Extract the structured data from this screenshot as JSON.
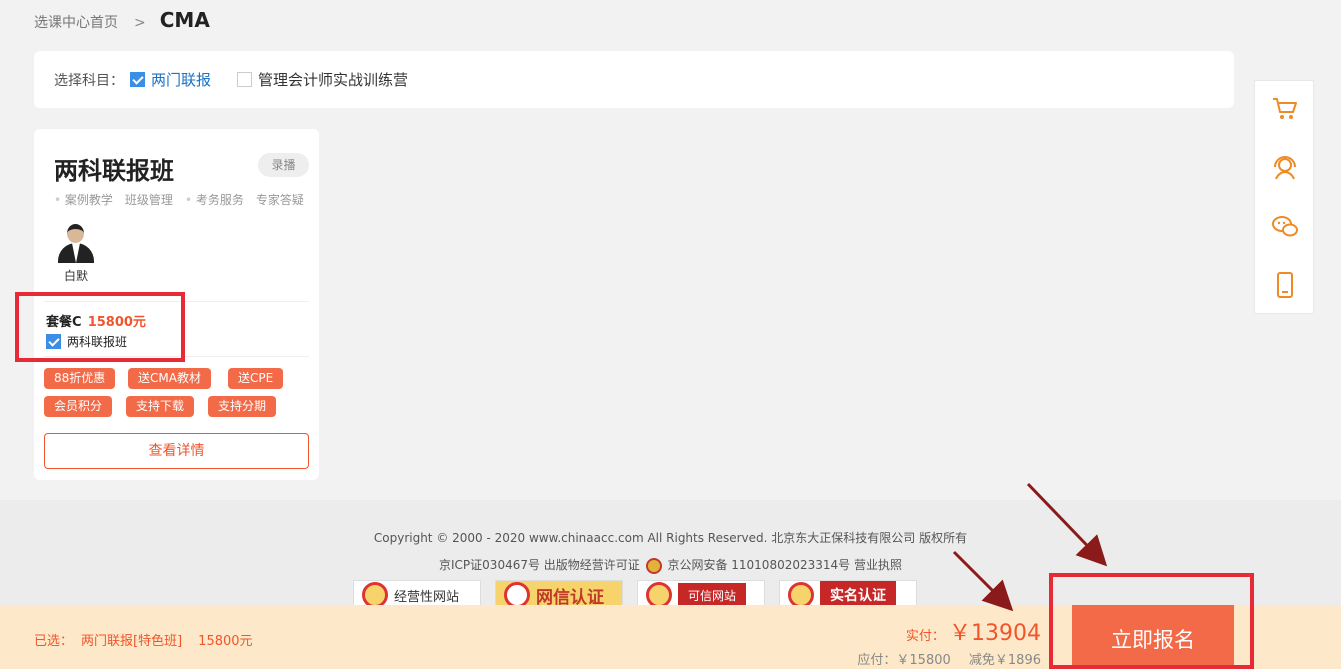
{
  "breadcrumb": {
    "home": "选课中心首页",
    "separator": ">",
    "current": "CMA"
  },
  "filter": {
    "label": "选择科目：",
    "options": [
      {
        "text": "两门联报",
        "checked": true
      },
      {
        "text": "管理会计师实战训练营",
        "checked": false
      }
    ]
  },
  "course": {
    "title": "两科联报班",
    "mode_badge": "录播",
    "features": [
      "案例教学",
      "班级管理",
      "考务服务",
      "专家答疑"
    ],
    "teacher_name": "白默",
    "package_name": "套餐C",
    "package_price": "15800元",
    "package_item": "两科联报班",
    "tags": [
      "88折优惠",
      "送CMA教材",
      "送CPE",
      "会员积分",
      "支持下载",
      "支持分期"
    ],
    "detail_button": "查看详情"
  },
  "sidebar": {
    "icons": [
      "cart-icon",
      "customer-service-icon",
      "chat-icon",
      "mobile-icon"
    ]
  },
  "footer": {
    "copyright": "Copyright © 2000 - 2020 www.chinaacc.com All Rights Reserved. 北京东大正保科技有限公司 版权所有",
    "icp_left": "京ICP证030467号 出版物经营许可证",
    "icp_right": "京公网安备 11010802023314号 营业执照",
    "badges": [
      "经营性网站",
      "网信认证",
      "可信网站",
      "实名认证"
    ]
  },
  "bottom_bar": {
    "selected_label": "已选：",
    "selected_item": "两门联报[特色班]",
    "selected_price": "15800元",
    "real_label": "实付：",
    "real_amount": "￥13904",
    "due_label": "应付：￥15800",
    "discount_label": "减免￥1896",
    "enroll_button": "立即报名"
  },
  "colors": {
    "accent": "#f26a47",
    "link": "#1a73c8",
    "highlight_box": "#e62a36",
    "arrow": "#8b1a1a"
  }
}
